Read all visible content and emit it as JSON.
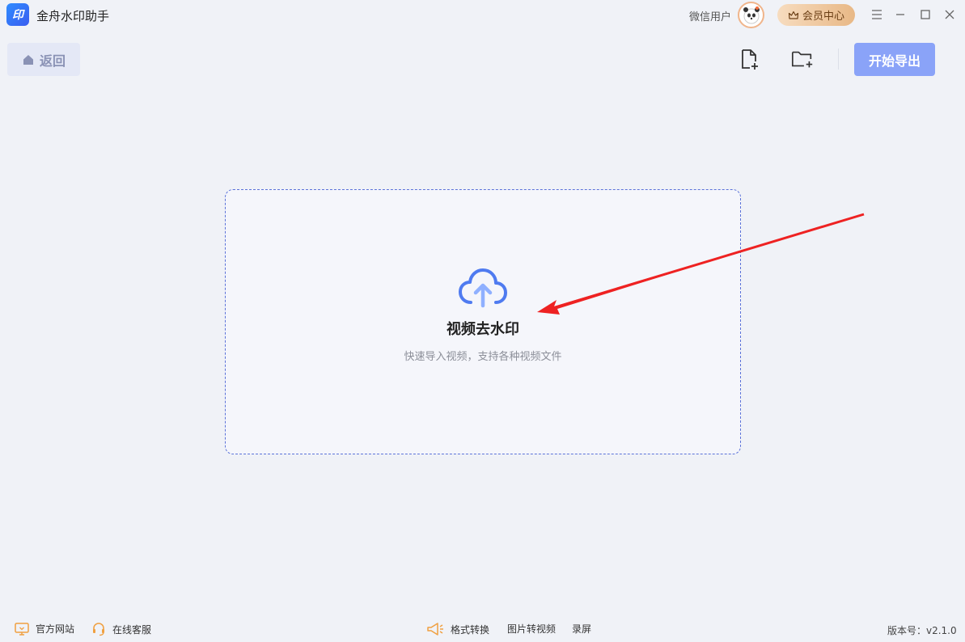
{
  "app": {
    "logo_text": "印",
    "title": "金舟水印助手"
  },
  "user": {
    "name": "微信用户",
    "vip_label": "会员中心"
  },
  "toolbar": {
    "back_label": "返回",
    "export_label": "开始导出"
  },
  "drop_zone": {
    "title": "视频去水印",
    "subtitle": "快速导入视频，支持各种视频文件"
  },
  "footer": {
    "left": [
      {
        "label": "官方网站",
        "icon": "monitor-icon"
      },
      {
        "label": "在线客服",
        "icon": "headset-icon"
      }
    ],
    "center": [
      {
        "label": "格式转换"
      },
      {
        "label": "图片转视频"
      },
      {
        "label": "录屏"
      }
    ],
    "version": "版本号：v2.1.0"
  },
  "colors": {
    "accent": "#5b72d9",
    "export_button": "#8aa3f8",
    "vip_gold": "#e8b886",
    "annotation_arrow": "#ee2222"
  }
}
